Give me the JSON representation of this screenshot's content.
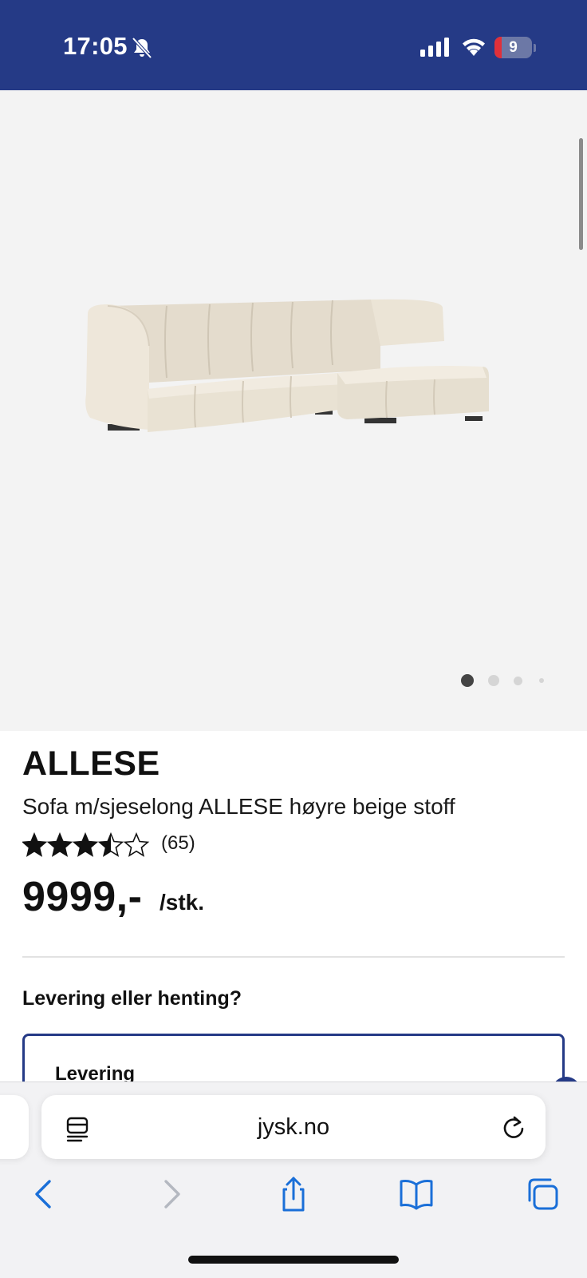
{
  "status_bar": {
    "time": "17:05",
    "battery_level": "9",
    "battery_fraction": 0.09,
    "background_color": "#253a86",
    "icons": [
      "bell-slash-icon",
      "cellular-signal-icon",
      "wifi-icon",
      "battery-icon"
    ]
  },
  "gallery": {
    "image": "beige-corner-sofa-image",
    "active_page": 1,
    "page_count": 4
  },
  "product": {
    "name": "ALLESE",
    "description": "Sofa m/sjeselong ALLESE høyre beige stoff",
    "rating": 3.5,
    "rating_max": 5,
    "review_count": "(65)",
    "price": "9999,-",
    "unit": "/stk."
  },
  "delivery": {
    "heading": "Levering eller henting?",
    "option_label": "Levering",
    "accent_color": "#253a86"
  },
  "browser": {
    "address": "jysk.no",
    "toolbar_icons": [
      "back-icon",
      "forward-icon",
      "share-icon",
      "bookmarks-icon",
      "tabs-icon"
    ],
    "accent_color": "#1a6fd8"
  }
}
